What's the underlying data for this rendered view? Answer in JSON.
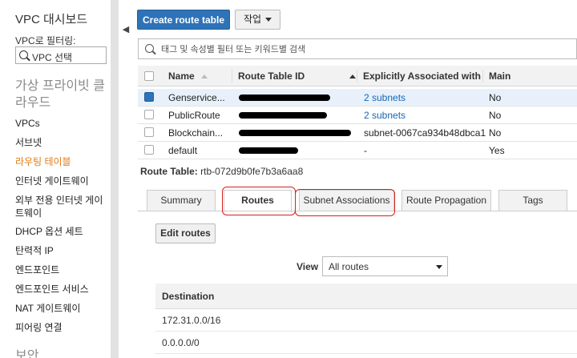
{
  "sidebar": {
    "title": "VPC 대시보드",
    "filter_label": "VPC로 필터링:",
    "filter_value": "VPC 선택",
    "section": "가상 프라이빗 클라우드",
    "items": [
      {
        "label": "VPCs"
      },
      {
        "label": "서브넷"
      },
      {
        "label": "라우팅 테이블",
        "active": true
      },
      {
        "label": "인터넷 게이트웨이"
      },
      {
        "label": "외부 전용 인터넷 게이트웨이"
      },
      {
        "label": "DHCP 옵션 세트"
      },
      {
        "label": "탄력적 IP"
      },
      {
        "label": "엔드포인트"
      },
      {
        "label": "엔드포인트 서비스"
      },
      {
        "label": "NAT 게이트웨이"
      },
      {
        "label": "피어링 연결"
      }
    ],
    "next_section": "보안"
  },
  "toolbar": {
    "create_label": "Create route table",
    "action_label": "작업"
  },
  "search": {
    "placeholder": "태그 및 속성별 필터 또는 키워드별 검색"
  },
  "table": {
    "columns": [
      "Name",
      "Route Table ID",
      "Explicitly Associated with",
      "Main"
    ],
    "rows": [
      {
        "name": "Genservice...",
        "assoc": "2 subnets",
        "assoc_link": true,
        "main": "No",
        "selected": true
      },
      {
        "name": "PublicRoute",
        "assoc": "2 subnets",
        "assoc_link": true,
        "main": "No",
        "selected": false
      },
      {
        "name": "Blockchain...",
        "assoc": "subnet-0067ca934b48dbca1",
        "assoc_link": false,
        "main": "No",
        "selected": false
      },
      {
        "name": "default",
        "assoc": "-",
        "assoc_link": false,
        "main": "Yes",
        "selected": false
      }
    ]
  },
  "detail": {
    "route_table_label": "Route Table:",
    "route_table_id": "rtb-072d9b0fe7b3a6aa8",
    "tabs": [
      "Summary",
      "Routes",
      "Subnet Associations",
      "Route Propagation",
      "Tags"
    ],
    "active_tab": "Routes",
    "edit_routes_label": "Edit routes",
    "view_label": "View",
    "view_value": "All routes",
    "routes_header": "Destination",
    "routes": [
      "172.31.0.0/16",
      "0.0.0.0/0"
    ]
  },
  "colors": {
    "primary_button": "#2e73b8",
    "link": "#1667b5",
    "active_nav": "#e47911",
    "annotation": "#d62020"
  }
}
